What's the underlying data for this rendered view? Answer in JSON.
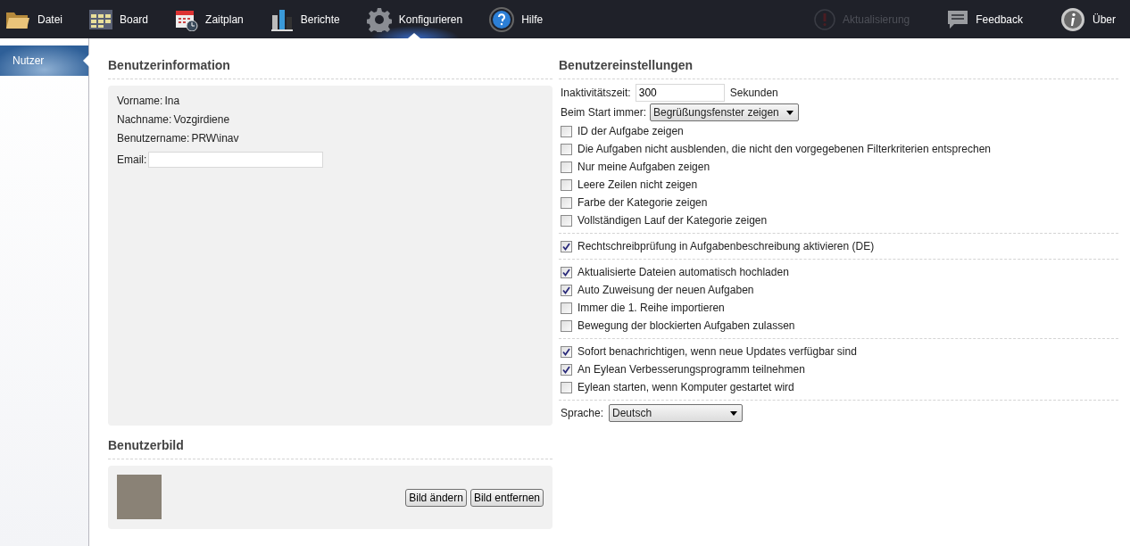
{
  "nav": {
    "left": [
      {
        "label": "Datei",
        "kind": "folder",
        "selected": false,
        "disabled": false
      },
      {
        "label": "Board",
        "kind": "board",
        "selected": false,
        "disabled": false
      },
      {
        "label": "Zaitplan",
        "kind": "calendar",
        "selected": false,
        "disabled": false
      },
      {
        "label": "Berichte",
        "kind": "chart",
        "selected": false,
        "disabled": false
      },
      {
        "label": "Konfigurieren",
        "kind": "gear",
        "selected": true,
        "disabled": false
      },
      {
        "label": "Hilfe",
        "kind": "help",
        "selected": false,
        "disabled": false
      }
    ],
    "right": [
      {
        "label": "Aktualisierung",
        "kind": "alert",
        "selected": false,
        "disabled": true
      },
      {
        "label": "Feedback",
        "kind": "comment",
        "selected": false,
        "disabled": false
      },
      {
        "label": "Über",
        "kind": "info",
        "selected": false,
        "disabled": false
      }
    ]
  },
  "sidebar": {
    "items": [
      {
        "label": "Nutzer",
        "selected": true
      }
    ]
  },
  "user_info": {
    "title": "Benutzerinformation",
    "fields": [
      {
        "label": "Vorname:",
        "value": "Ina"
      },
      {
        "label": "Nachname:",
        "value": "Vozgirdiene"
      },
      {
        "label": "Benutzername:",
        "value": "PRW\\inav"
      }
    ],
    "email": {
      "label": "Email:"
    }
  },
  "user_picture": {
    "title": "Benutzerbild",
    "buttons": [
      "Bild ändern",
      "Bild entfernen"
    ]
  },
  "settings": {
    "title": "Benutzereinstellungen",
    "inactivity": {
      "label": "Inaktivitätszeit:",
      "value": "300",
      "unit": "Sekunden"
    },
    "startup": {
      "label": "Beim Start immer:",
      "value": "Begrüßungsfenster zeigen"
    },
    "groups": [
      [
        {
          "label": "ID der Aufgabe zeigen",
          "checked": false
        },
        {
          "label": "Die Aufgaben nicht ausblenden, die nicht den vorgegebenen Filterkriterien entsprechen",
          "checked": false
        },
        {
          "label": "Nur meine Aufgaben zeigen",
          "checked": false
        },
        {
          "label": "Leere Zeilen nicht zeigen",
          "checked": false
        },
        {
          "label": "Farbe der Kategorie zeigen",
          "checked": false
        },
        {
          "label": "Vollständigen Lauf der Kategorie zeigen",
          "checked": false
        }
      ],
      [
        {
          "label": "Rechtschreibprüfung in Aufgabenbeschreibung aktivieren (DE)",
          "checked": true
        }
      ],
      [
        {
          "label": "Aktualisierte Dateien automatisch hochladen",
          "checked": true
        },
        {
          "label": "Auto Zuweisung der neuen Aufgaben",
          "checked": true
        },
        {
          "label": "Immer die 1. Reihe importieren",
          "checked": false
        },
        {
          "label": "Bewegung der blockierten Aufgaben zulassen",
          "checked": false
        }
      ],
      [
        {
          "label": "Sofort benachrichtigen, wenn neue Updates verfügbar sind",
          "checked": true
        },
        {
          "label": "An Eylean Verbesserungsprogramm teilnehmen",
          "checked": true
        },
        {
          "label": "Eylean starten, wenn Komputer gestartet wird",
          "checked": false
        }
      ]
    ],
    "language": {
      "label": "Sprache:",
      "value": "Deutsch"
    }
  }
}
